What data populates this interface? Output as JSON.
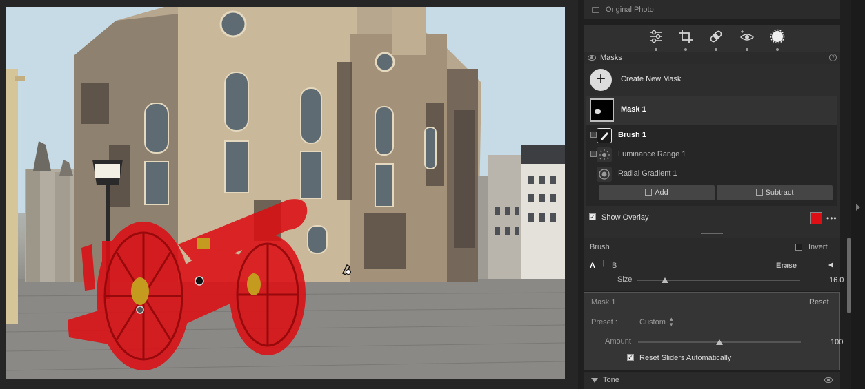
{
  "photo": {
    "mask_overlay_color": "#dc0f14",
    "cursor_icon": "brush-cursor-icon"
  },
  "panel": {
    "original_photo_label": "Original Photo",
    "tool_icons": [
      "edit-sliders-icon",
      "crop-icon",
      "healing-bandage-icon",
      "red-eye-icon",
      "masking-icon"
    ],
    "masks": {
      "title": "Masks",
      "help": "?",
      "create_new_label": "Create New Mask",
      "create_plus": "+",
      "mask1_label": "Mask 1",
      "components": [
        {
          "label": "Brush 1",
          "icon": "brush-icon",
          "selected": true
        },
        {
          "label": "Luminance Range 1",
          "icon": "luminance-icon"
        },
        {
          "label": "Radial Gradient 1",
          "icon": "radial-gradient-icon"
        }
      ],
      "add_label": "Add",
      "subtract_label": "Subtract",
      "show_overlay_label": "Show Overlay",
      "show_overlay_checked": true,
      "overlay_color": "#dc0f14",
      "more": "•••"
    },
    "brush": {
      "title": "Brush",
      "invert_label": "Invert",
      "tab_a": "A",
      "tab_b": "B",
      "erase_label": "Erase",
      "size_label": "Size",
      "size_value": "16.0",
      "size_fraction": 0.17
    },
    "adjust": {
      "title": "Mask 1",
      "reset_label": "Reset",
      "preset_label": "Preset :",
      "preset_value": "Custom",
      "amount_label": "Amount",
      "amount_value": "100",
      "amount_fraction": 0.5,
      "reset_sliders_label": "Reset Sliders Automatically",
      "reset_sliders_checked": true
    },
    "tone": {
      "title": "Tone"
    }
  }
}
